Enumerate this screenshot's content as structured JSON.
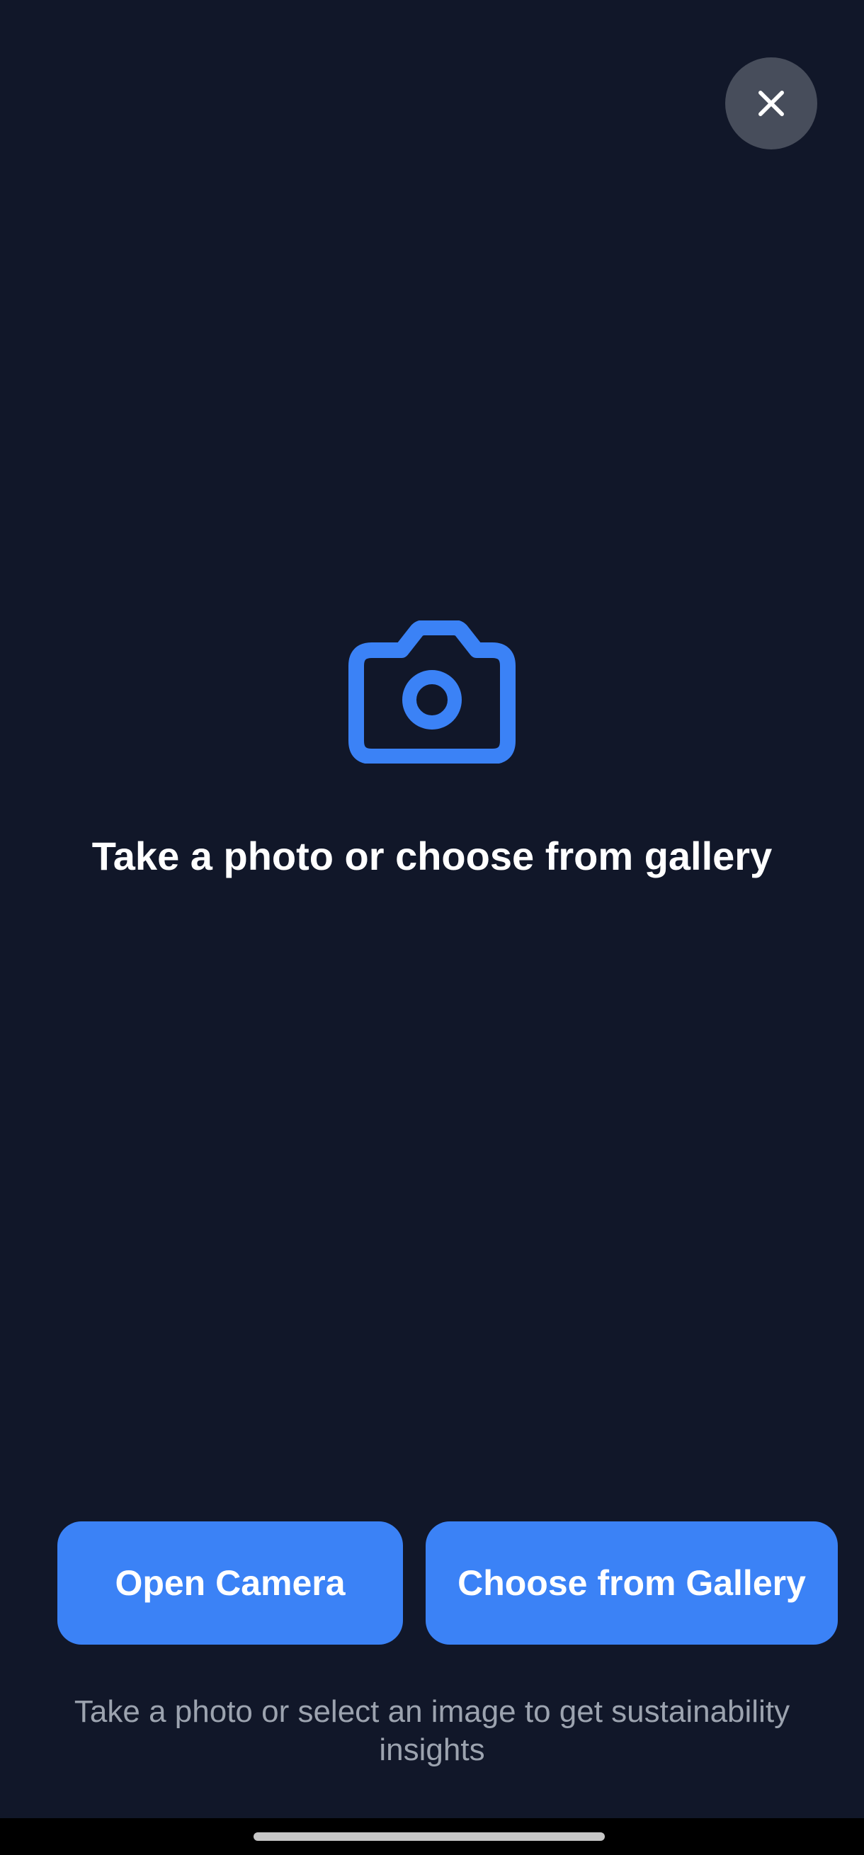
{
  "dialog": {
    "close_icon": "close-icon",
    "camera_icon": "camera-icon",
    "title": "Take a photo or choose from gallery",
    "buttons": {
      "open_camera": "Open Camera",
      "choose_gallery": "Choose from Gallery"
    },
    "helper_text": "Take a photo or select an image to get sustainability insights"
  },
  "colors": {
    "background": "#111729",
    "accent": "#3b82f6",
    "close_button_bg": "#474d5b",
    "helper_text": "#9ca3af"
  }
}
